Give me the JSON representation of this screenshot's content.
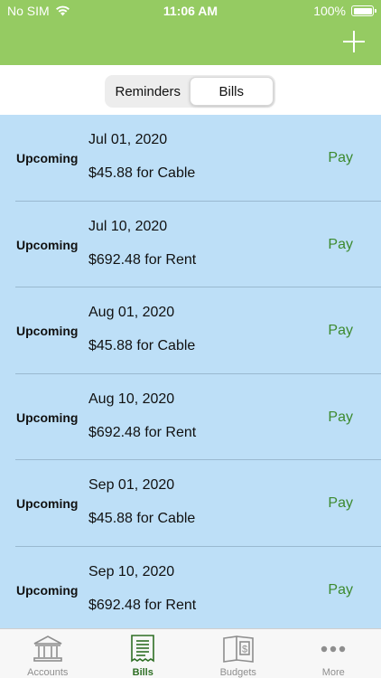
{
  "status_bar": {
    "carrier": "No SIM",
    "time": "11:06 AM",
    "battery": "100%"
  },
  "nav": {
    "add_icon": "plus-icon"
  },
  "segments": [
    {
      "label": "Reminders",
      "active": false
    },
    {
      "label": "Bills",
      "active": true
    }
  ],
  "bills": [
    {
      "status": "Upcoming",
      "date": "Jul 01, 2020",
      "amount": "$45.88 for Cable",
      "action": "Pay"
    },
    {
      "status": "Upcoming",
      "date": "Jul 10, 2020",
      "amount": "$692.48 for Rent",
      "action": "Pay"
    },
    {
      "status": "Upcoming",
      "date": "Aug 01, 2020",
      "amount": "$45.88 for Cable",
      "action": "Pay"
    },
    {
      "status": "Upcoming",
      "date": "Aug 10, 2020",
      "amount": "$692.48 for Rent",
      "action": "Pay"
    },
    {
      "status": "Upcoming",
      "date": "Sep 01, 2020",
      "amount": "$45.88 for Cable",
      "action": "Pay"
    },
    {
      "status": "Upcoming",
      "date": "Sep 10, 2020",
      "amount": "$692.48 for Rent",
      "action": "Pay"
    }
  ],
  "tabs": [
    {
      "label": "Accounts",
      "icon": "bank-icon",
      "active": false
    },
    {
      "label": "Bills",
      "icon": "bill-icon",
      "active": true
    },
    {
      "label": "Budgets",
      "icon": "budget-book-icon",
      "active": false
    },
    {
      "label": "More",
      "icon": "more-dots-icon",
      "active": false
    }
  ],
  "colors": {
    "header_green": "#95cb62",
    "list_blue": "#bddff7",
    "pay_green": "#3c8a2e",
    "active_tab_green": "#2f6f25"
  }
}
